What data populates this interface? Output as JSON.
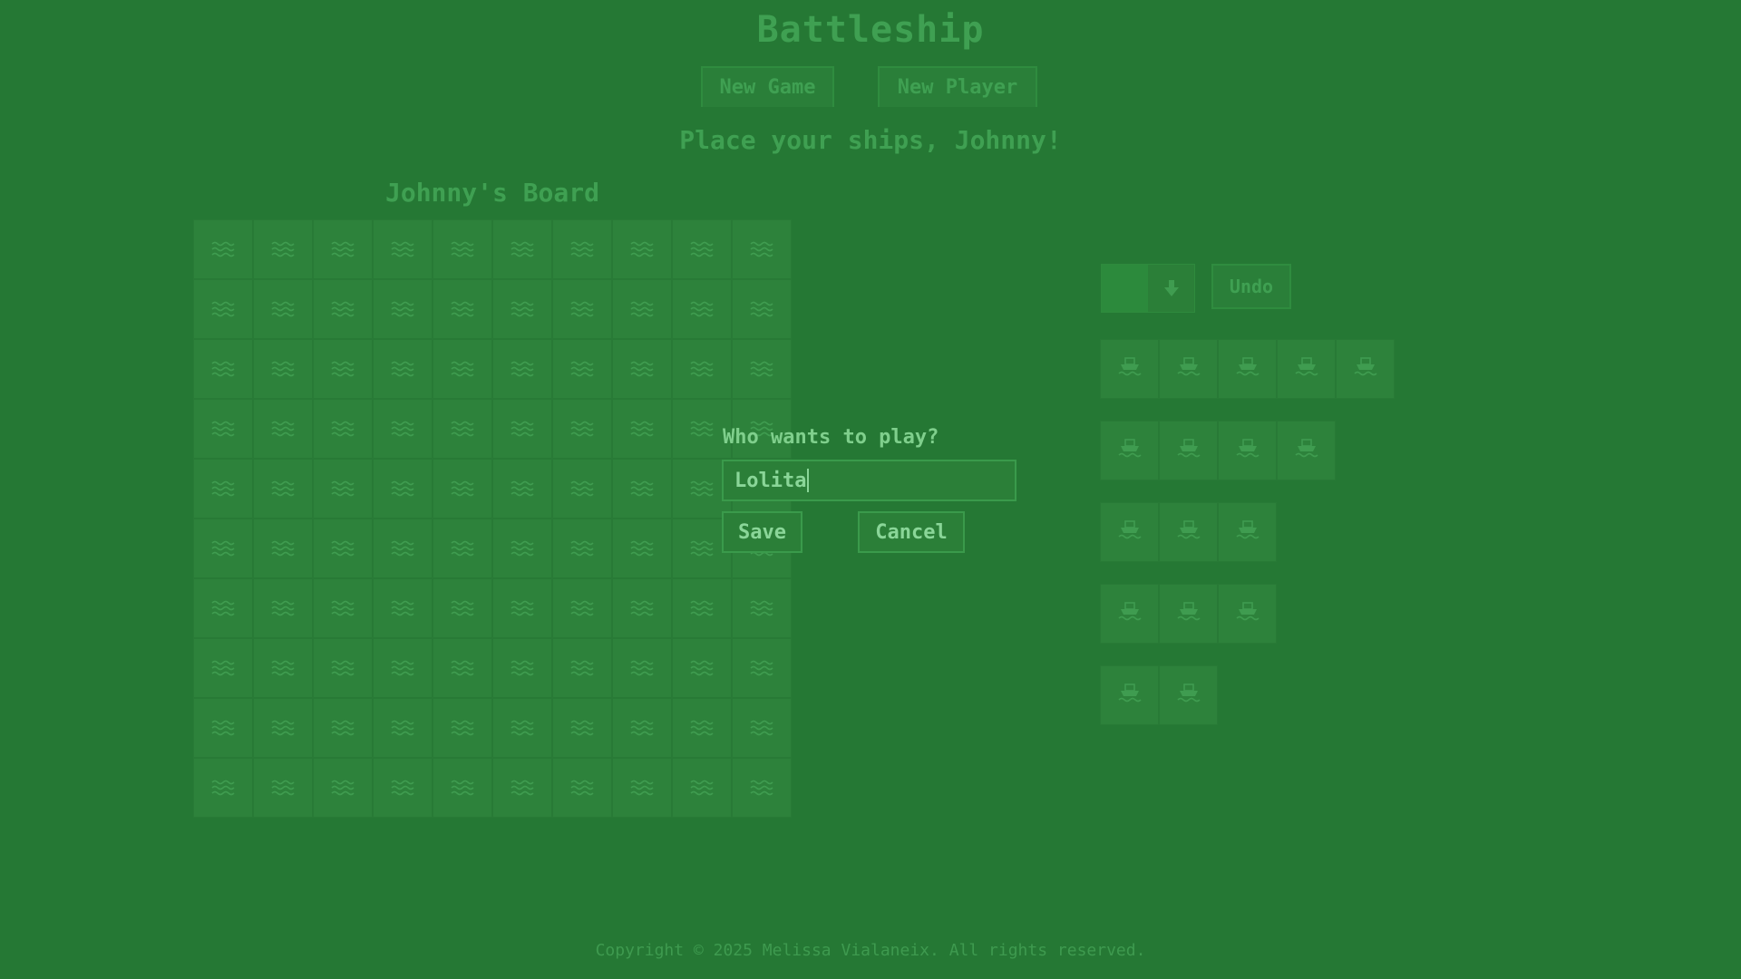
{
  "header": {
    "title": "Battleship",
    "new_game_label": "New Game",
    "new_player_label": "New Player"
  },
  "status": {
    "prompt": "Place your ships, Johnny!"
  },
  "board": {
    "title": "Johnny's Board",
    "rows": 10,
    "cols": 10,
    "cell_icon": "waves-icon"
  },
  "placement": {
    "orientation_icon": "arrow-down-icon",
    "undo_label": "Undo",
    "ship_icon": "ship-icon",
    "fleet": [
      5,
      4,
      3,
      3,
      2
    ]
  },
  "modal": {
    "question": "Who wants to play?",
    "input_value": "Lolita",
    "save_label": "Save",
    "cancel_label": "Cancel"
  },
  "footer": {
    "copyright": "Copyright © 2025 Melissa Vialaneix. All rights reserved."
  },
  "colors": {
    "background": "#257834",
    "text_dim": "#3fa052",
    "text_bright": "#8ad698",
    "icon": "#3f9c50"
  }
}
